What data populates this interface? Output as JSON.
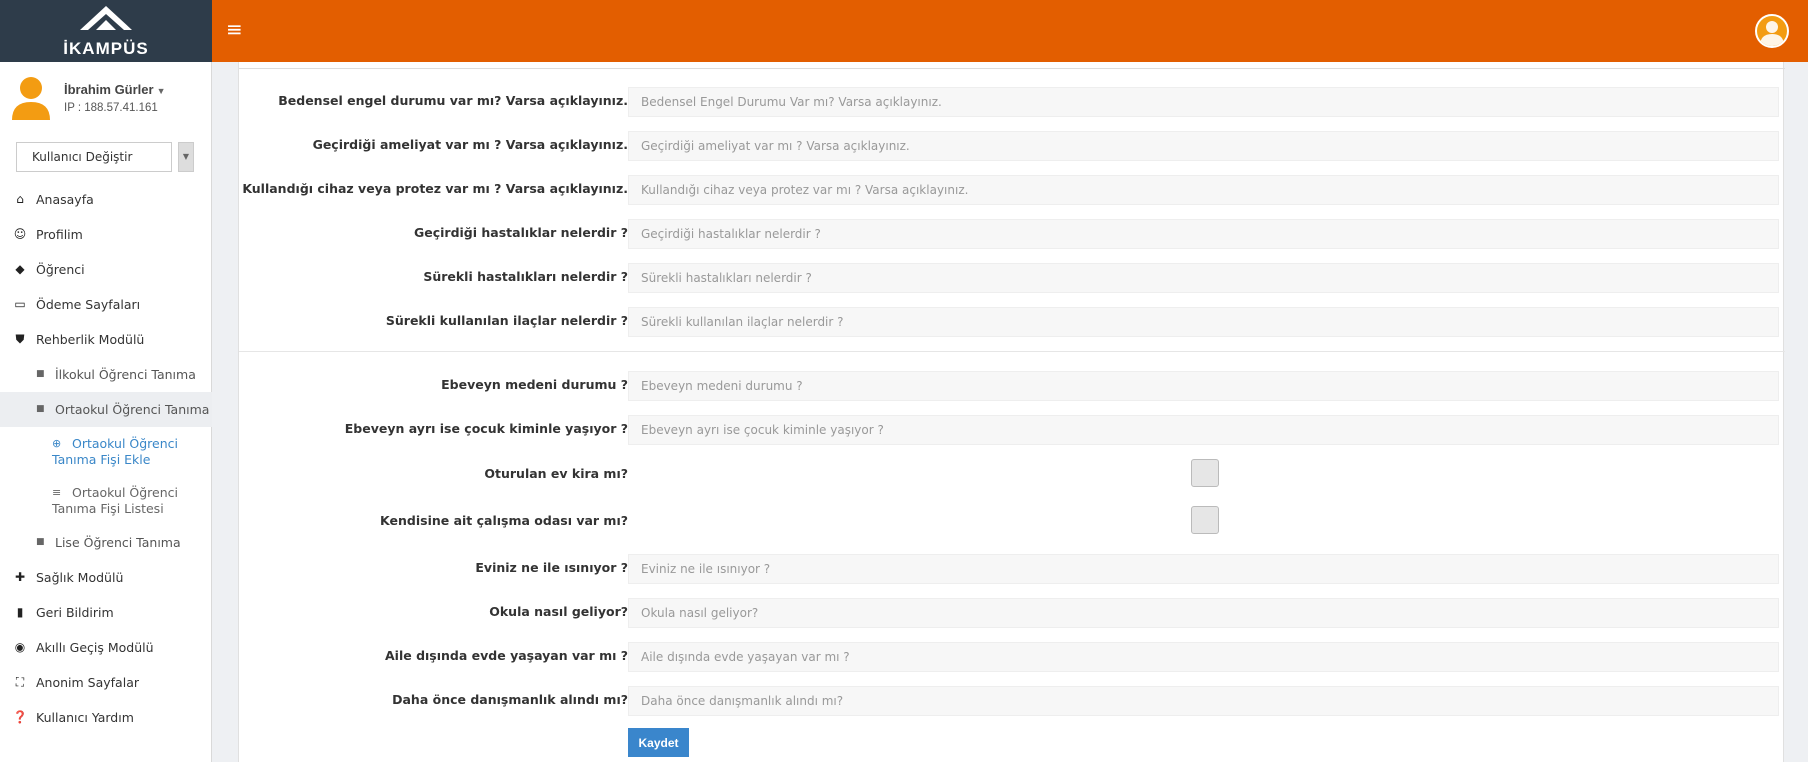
{
  "brand": {
    "name": "İKAMPÜS"
  },
  "user": {
    "name": "İbrahim Gürler",
    "ip": "IP : 188.57.41.161",
    "switch_label": "Kullanıcı Değiştir"
  },
  "nav": {
    "items": [
      {
        "label": "Anasayfa",
        "icon": "home-icon"
      },
      {
        "label": "Profilim",
        "icon": "profile-icon"
      },
      {
        "label": "Öğrenci",
        "icon": "graduation-cap-icon"
      },
      {
        "label": "Ödeme Sayfaları",
        "icon": "credit-card-icon"
      },
      {
        "label": "Rehberlik Modülü",
        "icon": "shield-check-icon"
      }
    ],
    "sub": [
      {
        "label": "İlkokul Öğrenci Tanıma"
      },
      {
        "label": "Ortaokul Öğrenci Tanıma"
      }
    ],
    "sub2": [
      {
        "label": "Ortaokul Öğrenci Tanıma Fişi Ekle",
        "current": true
      },
      {
        "label": "Ortaokul Öğrenci Tanıma Fişi Listesi"
      }
    ],
    "sub_last": {
      "label": "Lise Öğrenci Tanıma"
    },
    "items2": [
      {
        "label": "Sağlık Modülü",
        "icon": "bandage-icon"
      },
      {
        "label": "Geri Bildirim",
        "icon": "book-icon"
      },
      {
        "label": "Akıllı Geçiş Modülü",
        "icon": "compass-icon"
      },
      {
        "label": "Anonim Sayfalar",
        "icon": "expand-icon"
      },
      {
        "label": "Kullanıcı Yardım",
        "icon": "question-circle-icon"
      }
    ]
  },
  "form": {
    "rows1": [
      {
        "label": "Bedensel engel durumu var mı? Varsa açıklayınız.",
        "placeholder": "Bedensel Engel Durumu Var mı? Varsa açıklayınız."
      },
      {
        "label": "Geçirdiği ameliyat var mı ? Varsa açıklayınız.",
        "placeholder": "Geçirdiği ameliyat var mı ? Varsa açıklayınız."
      },
      {
        "label": "Kullandığı cihaz veya protez var mı ? Varsa açıklayınız.",
        "placeholder": "Kullandığı cihaz veya protez var mı ? Varsa açıklayınız."
      },
      {
        "label": "Geçirdiği hastalıklar nelerdir ?",
        "placeholder": "Geçirdiği hastalıklar nelerdir ?"
      },
      {
        "label": "Sürekli hastalıkları nelerdir ?",
        "placeholder": "Sürekli hastalıkları nelerdir ?"
      },
      {
        "label": "Sürekli kullanılan ilaçlar nelerdir ?",
        "placeholder": "Sürekli kullanılan ilaçlar nelerdir ?"
      }
    ],
    "parent_status": {
      "label": "Ebeveyn medeni durumu ?",
      "placeholder": "Ebeveyn medeni durumu ?"
    },
    "child_lives_with": {
      "label": "Ebeveyn ayrı ise çocuk kiminle yaşıyor ?",
      "placeholder": "Ebeveyn ayrı ise çocuk kiminle yaşıyor ?"
    },
    "rented_house": {
      "label": "Oturulan ev kira mı?",
      "checked": false
    },
    "study_room": {
      "label": "Kendisine ait çalışma odası var mı?",
      "checked": false
    },
    "rows3": [
      {
        "label": "Eviniz ne ile ısınıyor ?",
        "placeholder": "Eviniz ne ile ısınıyor ?"
      },
      {
        "label": "Okula nasıl geliyor?",
        "placeholder": "Okula nasıl geliyor?"
      },
      {
        "label": "Aile dışında evde yaşayan var mı ?",
        "placeholder": "Aile dışında evde yaşayan var mı ?"
      },
      {
        "label": "Daha önce danışmanlık alındı mı?",
        "placeholder": "Daha önce danışmanlık alındı mı?"
      }
    ],
    "save_label": "Kaydet"
  },
  "colors": {
    "topbar": "#e35e00",
    "sidebar_logo": "#2e3c4a",
    "save_button": "#3a86cc",
    "link_active": "#3a87c8"
  }
}
